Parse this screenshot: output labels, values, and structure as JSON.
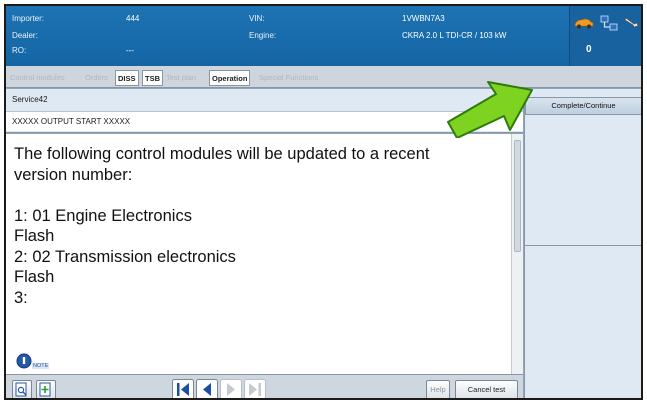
{
  "header": {
    "importer_label": "Importer:",
    "importer_value": "444",
    "dealer_label": "Dealer:",
    "dealer_value": "",
    "ro_label": "RO:",
    "ro_value": "---",
    "vin_label": "VIN:",
    "vin_value": "1VWBN7A3",
    "engine_label": "Engine:",
    "engine_value": "CKRA 2.0 L TDI-CR / 103 kW",
    "counter_value": "0",
    "icons": [
      "car-icon",
      "network-icon",
      "connector-icon"
    ]
  },
  "tabs": [
    {
      "label": "Control modules",
      "state": "disabled"
    },
    {
      "label": "Orders",
      "state": "disabled"
    },
    {
      "label": "DISS",
      "state": "enabled"
    },
    {
      "label": "TSB",
      "state": "enabled"
    },
    {
      "label": "Test plan",
      "state": "disabled"
    },
    {
      "label": "Operation",
      "state": "active"
    },
    {
      "label": "Special Functions",
      "state": "disabled"
    }
  ],
  "main": {
    "service_label": "Service42",
    "output_label": "XXXXX OUTPUT START XXXXX",
    "message_lines": [
      "The following control modules will be updated to a recent",
      "version number:",
      "",
      "1: 01 Engine Electronics",
      "Flash",
      "2: 02 Transmission electronics",
      "Flash",
      "3:"
    ],
    "info_label": "NOTE"
  },
  "toolbar": {
    "help_label": "Help",
    "cancel_label": "Cancel test"
  },
  "right_panel": {
    "complete_label": "Complete/Continue"
  },
  "colors": {
    "header_blue": "#1d73b3",
    "arrow_green": "#7ed321",
    "nav_blue": "#1b4fa0",
    "panel_bg": "#dfe9f4"
  }
}
